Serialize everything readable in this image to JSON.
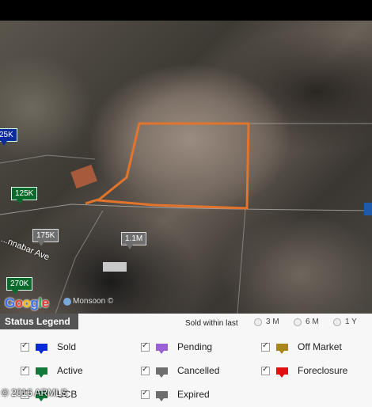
{
  "map": {
    "price_pins": [
      {
        "label": "25K",
        "color": "#0b2a9c"
      },
      {
        "label": "125K",
        "color": "#0a6a2c"
      },
      {
        "label": "175K",
        "color": "#6e6e6e"
      },
      {
        "label": "1.1M",
        "color": "#6e6e6e"
      },
      {
        "label": "270K",
        "color": "#0a6a2c"
      }
    ],
    "street_label": "...nnabar Ave",
    "parcel_outline_color": "#e2742b",
    "logo_text": "Google",
    "attribution": "Monsoon ©"
  },
  "legend": {
    "title": "Status Legend",
    "sold_within_label": "Sold within last",
    "sold_within_options": [
      "3 M",
      "6 M",
      "1 Y"
    ],
    "statuses": [
      {
        "label": "Sold",
        "color": "#0a2ad8",
        "checked": true
      },
      {
        "label": "Pending",
        "color": "#9b5fd6",
        "checked": true
      },
      {
        "label": "Off Market",
        "color": "#a8861a",
        "checked": true
      },
      {
        "label": "Active",
        "color": "#0f7a3a",
        "checked": true
      },
      {
        "label": "Cancelled",
        "color": "#6e6e6e",
        "checked": true
      },
      {
        "label": "Foreclosure",
        "color": "#e01010",
        "checked": true
      },
      {
        "label": "UCB",
        "color": "#0f7a3a",
        "checked": true
      },
      {
        "label": "Expired",
        "color": "#6e6e6e",
        "checked": true
      }
    ]
  },
  "copyright": "© 2016 ARMLS"
}
